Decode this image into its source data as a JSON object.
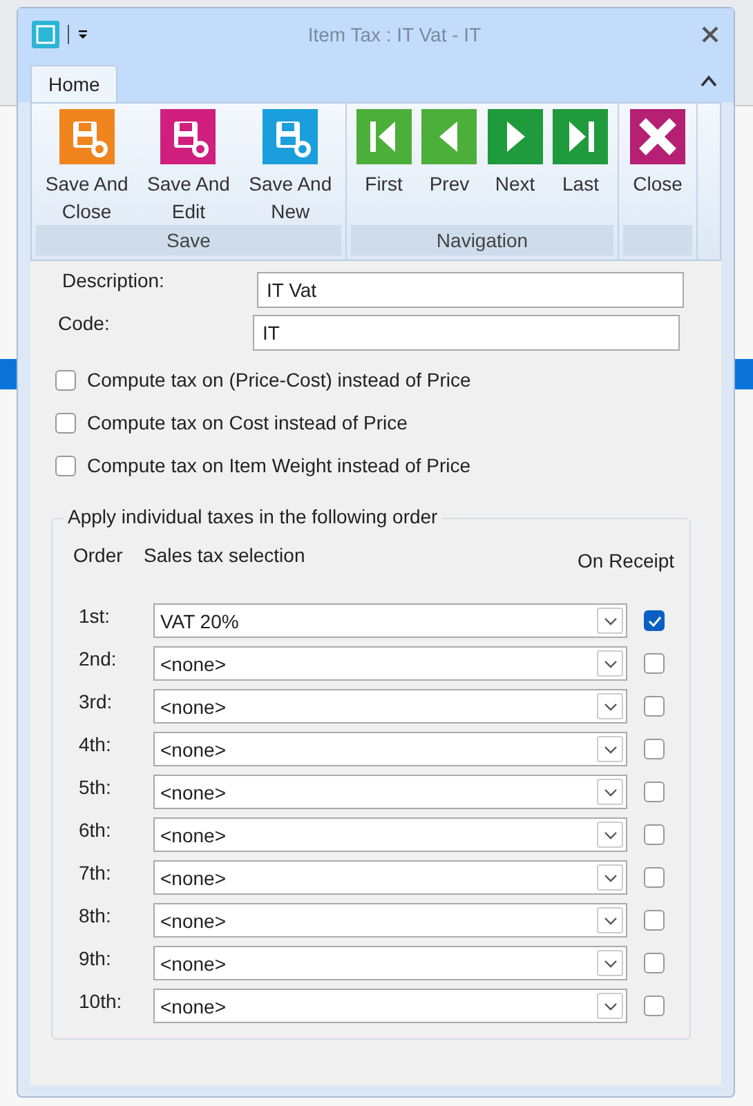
{
  "window": {
    "title": "Item Tax : IT Vat - IT"
  },
  "ribbon": {
    "tabs": [
      {
        "label": "Home",
        "selected": true
      }
    ],
    "groups": [
      {
        "label": "Save",
        "buttons": [
          {
            "label": "Save And Close"
          },
          {
            "label": "Save And Edit"
          },
          {
            "label": "Save And New"
          }
        ]
      },
      {
        "label": "Navigation",
        "buttons": [
          {
            "label": "First"
          },
          {
            "label": "Prev"
          },
          {
            "label": "Next"
          },
          {
            "label": "Last"
          }
        ]
      },
      {
        "buttons": [
          {
            "label": "Close"
          }
        ]
      }
    ]
  },
  "form": {
    "description": {
      "label": "Description:",
      "value": "IT Vat"
    },
    "code": {
      "label": "Code:",
      "value": "IT"
    },
    "options": [
      {
        "label": "Compute tax on (Price-Cost) instead of Price",
        "checked": false
      },
      {
        "label": "Compute tax on Cost instead of Price",
        "checked": false
      },
      {
        "label": "Compute tax on Item Weight instead of Price",
        "checked": false
      }
    ],
    "tax_order": {
      "title": "Apply individual taxes in the following order",
      "columns": [
        "Order",
        "Sales tax selection",
        "On Receipt"
      ],
      "rows": [
        {
          "order": "1st:",
          "selection": "VAT 20%",
          "on_receipt": true
        },
        {
          "order": "2nd:",
          "selection": "<none>",
          "on_receipt": false
        },
        {
          "order": "3rd:",
          "selection": "<none>",
          "on_receipt": false
        },
        {
          "order": "4th:",
          "selection": "<none>",
          "on_receipt": false
        },
        {
          "order": "5th:",
          "selection": "<none>",
          "on_receipt": false
        },
        {
          "order": "6th:",
          "selection": "<none>",
          "on_receipt": false
        },
        {
          "order": "7th:",
          "selection": "<none>",
          "on_receipt": false
        },
        {
          "order": "8th:",
          "selection": "<none>",
          "on_receipt": false
        },
        {
          "order": "9th:",
          "selection": "<none>",
          "on_receipt": false
        },
        {
          "order": "10th:",
          "selection": "<none>",
          "on_receipt": false
        }
      ]
    }
  }
}
